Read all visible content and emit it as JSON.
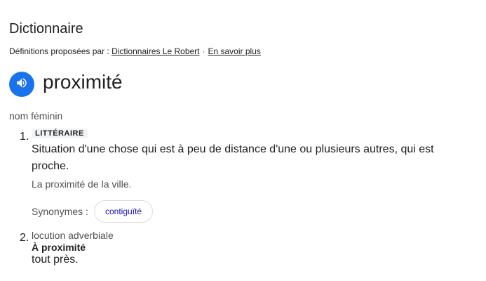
{
  "header": {
    "title": "Dictionnaire",
    "attribution_prefix": "Définitions proposées par :",
    "source_link": "Dictionnaires Le Robert",
    "separator": "·",
    "more_link": "En savoir plus"
  },
  "entry": {
    "word": "proximité",
    "speaker_icon": "volume-icon",
    "part_of_speech": "nom féminin",
    "senses": [
      {
        "number": "1.",
        "register": "LITTÉRAIRE",
        "definition": "Situation d'une chose qui est à peu de distance d'une ou plusieurs autres, qui est proche.",
        "example": "La proximité de la ville.",
        "synonyms_label": "Synonymes :",
        "synonyms": [
          "contiguïté"
        ]
      },
      {
        "number": "2.",
        "category": "locution adverbiale",
        "phrase": "À proximité",
        "definition": "tout près."
      }
    ]
  },
  "colors": {
    "accent": "#1a73e8",
    "link": "#1a0dab",
    "text": "#202124",
    "muted": "#4d5156"
  }
}
